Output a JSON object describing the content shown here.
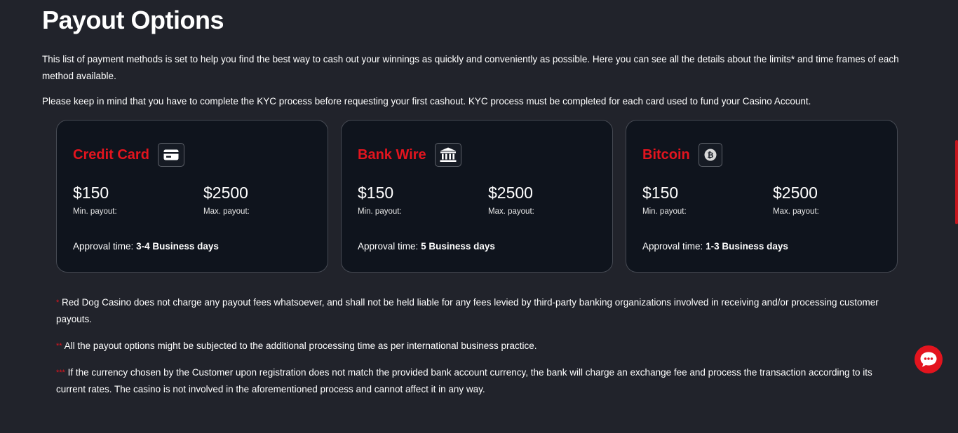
{
  "page": {
    "title": "Payout Options",
    "intro": "This list of payment methods is set to help you find the best way to cash out your winnings as quickly and conveniently as possible. Here you can see all the details about the limits* and time frames of each method available.",
    "kyc": "Please keep in mind that you have to complete the KYC process before requesting your first cashout. KYC process must be completed for each card used to fund your Casino Account."
  },
  "cards": [
    {
      "name": "Credit Card",
      "icon": "credit-card-icon",
      "min": "$150",
      "min_label": "Min. payout:",
      "max": "$2500",
      "max_label": "Max. payout:",
      "approval_label": "Approval time:",
      "approval_value": "3-4 Business days"
    },
    {
      "name": "Bank Wire",
      "icon": "bank-icon",
      "min": "$150",
      "min_label": "Min. payout:",
      "max": "$2500",
      "max_label": "Max. payout:",
      "approval_label": "Approval time:",
      "approval_value": "5 Business days"
    },
    {
      "name": "Bitcoin",
      "icon": "bitcoin-icon",
      "min": "$150",
      "min_label": "Min. payout:",
      "max": "$2500",
      "max_label": "Max. payout:",
      "approval_label": "Approval time:",
      "approval_value": "1-3 Business days"
    }
  ],
  "notes": [
    {
      "marker": "*",
      "text": "Red Dog Casino does not charge any payout fees whatsoever, and shall not be held liable for any fees levied by third-party banking organizations involved in receiving and/or processing customer payouts."
    },
    {
      "marker": "**",
      "text": "All the payout options might be subjected to the additional processing time as per international business practice."
    },
    {
      "marker": "***",
      "text": "If the currency chosen by the Customer upon registration does not match the provided bank account currency, the bank will charge an exchange fee and process the transaction according to its current rates. The casino is not involved in the aforementioned process and cannot affect it in any way."
    }
  ],
  "chat": {
    "icon": "chat-bubble-icon"
  },
  "colors": {
    "background": "#21232b",
    "card": "#0f141d",
    "accent": "#e3141e"
  }
}
